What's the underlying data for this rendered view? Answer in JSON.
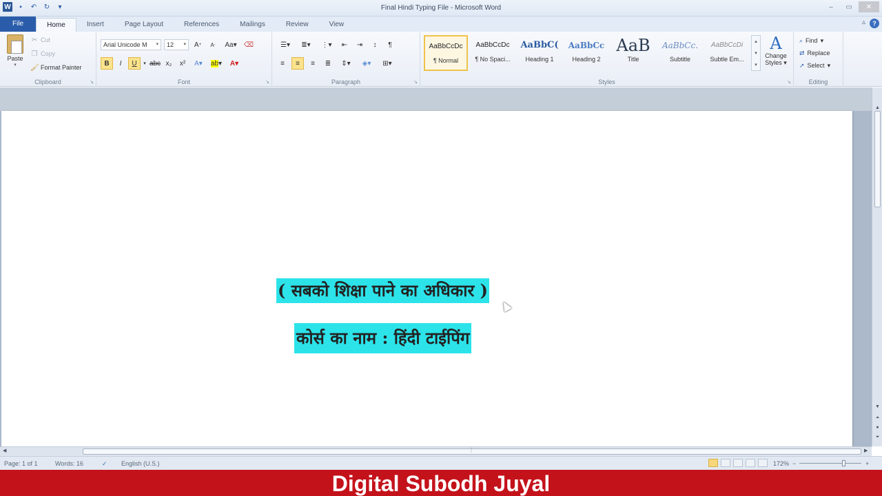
{
  "window": {
    "title": "Final Hindi Typing File - Microsoft Word",
    "controls": [
      "–",
      "▭",
      "✕"
    ]
  },
  "tabs": [
    "File",
    "Home",
    "Insert",
    "Page Layout",
    "References",
    "Mailings",
    "Review",
    "View"
  ],
  "active_tab": "Home",
  "ribbon": {
    "clipboard": {
      "paste": "Paste",
      "cut": "Cut",
      "copy": "Copy",
      "format_painter": "Format Painter",
      "label": "Clipboard"
    },
    "font": {
      "family": "Arial Unicode M",
      "size": "12",
      "label": "Font"
    },
    "paragraph": {
      "label": "Paragraph"
    },
    "styles": {
      "items": [
        {
          "sample": "AaBbCcDc",
          "name": "¶ Normal"
        },
        {
          "sample": "AaBbCcDc",
          "name": "¶ No Spaci..."
        },
        {
          "sample": "AaBbC(",
          "name": "Heading 1"
        },
        {
          "sample": "AaBbCc",
          "name": "Heading 2"
        },
        {
          "sample": "AaB",
          "name": "Title"
        },
        {
          "sample": "AaBbCc.",
          "name": "Subtitle"
        },
        {
          "sample": "AaBbCcDi",
          "name": "Subtle Em..."
        }
      ],
      "change_styles": "Change Styles",
      "label": "Styles"
    },
    "editing": {
      "find": "Find",
      "replace": "Replace",
      "select": "Select",
      "label": "Editing"
    }
  },
  "document": {
    "line1": "( सबको शिक्षा पाने का अधिकार )",
    "line2": "कोर्स का नाम : हिंदी टाईपिंग",
    "highlight_color": "#2ce3ea"
  },
  "statusbar": {
    "page": "Page: 1 of 1",
    "words": "Words: 16",
    "language": "English (U.S.)",
    "zoom": "172%"
  },
  "watermark": "Digital Subodh Juyal"
}
